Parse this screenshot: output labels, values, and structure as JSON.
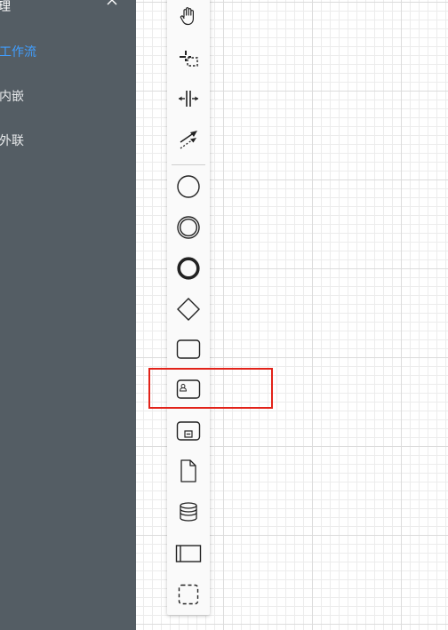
{
  "sidebar": {
    "header": {
      "label": "理",
      "chevron_icon": "chevron-up-icon"
    },
    "items": [
      {
        "label": "工作流",
        "active": true
      },
      {
        "label": "内嵌",
        "active": false
      },
      {
        "label": "外联",
        "active": false
      }
    ],
    "colors": {
      "background": "#545d64",
      "text": "#e8eaec",
      "active": "#409eff"
    }
  },
  "palette": {
    "tools": [
      {
        "icon": "hand-tool-icon"
      },
      {
        "icon": "lasso-tool-icon"
      },
      {
        "icon": "space-tool-icon"
      },
      {
        "icon": "global-connect-tool-icon"
      },
      {
        "icon": "start-event-icon"
      },
      {
        "icon": "intermediate-event-icon"
      },
      {
        "icon": "end-event-icon"
      },
      {
        "icon": "gateway-icon"
      },
      {
        "icon": "task-icon"
      },
      {
        "icon": "user-task-icon"
      },
      {
        "icon": "subprocess-icon"
      },
      {
        "icon": "data-object-icon"
      },
      {
        "icon": "data-store-icon"
      },
      {
        "icon": "participant-pool-icon"
      },
      {
        "icon": "group-icon"
      }
    ]
  },
  "annotation": {
    "highlight_color": "#e2231a",
    "highlighted_tool": "user-task-icon"
  }
}
